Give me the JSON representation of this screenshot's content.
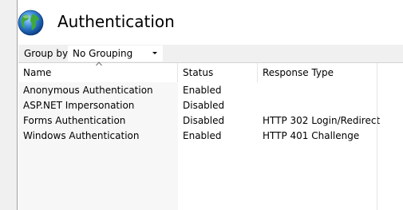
{
  "header": {
    "title": "Authentication",
    "icon": "globe-icon"
  },
  "toolbar": {
    "group_by_label": "Group by:",
    "group_by_value": "No Grouping"
  },
  "table": {
    "columns": [
      "Name",
      "Status",
      "Response Type"
    ],
    "sort_column": "Name",
    "rows": [
      {
        "name": "Anonymous Authentication",
        "status": "Enabled",
        "response": ""
      },
      {
        "name": "ASP.NET Impersonation",
        "status": "Disabled",
        "response": ""
      },
      {
        "name": "Forms Authentication",
        "status": "Disabled",
        "response": "HTTP 302 Login/Redirect"
      },
      {
        "name": "Windows Authentication",
        "status": "Enabled",
        "response": "HTTP 401 Challenge"
      }
    ]
  },
  "colors": {
    "panel_bg": "#f0f0f0",
    "name_column_bg": "#f7f7f7",
    "globe_blue": "#2f7fd0",
    "globe_green": "#3fa83a"
  }
}
